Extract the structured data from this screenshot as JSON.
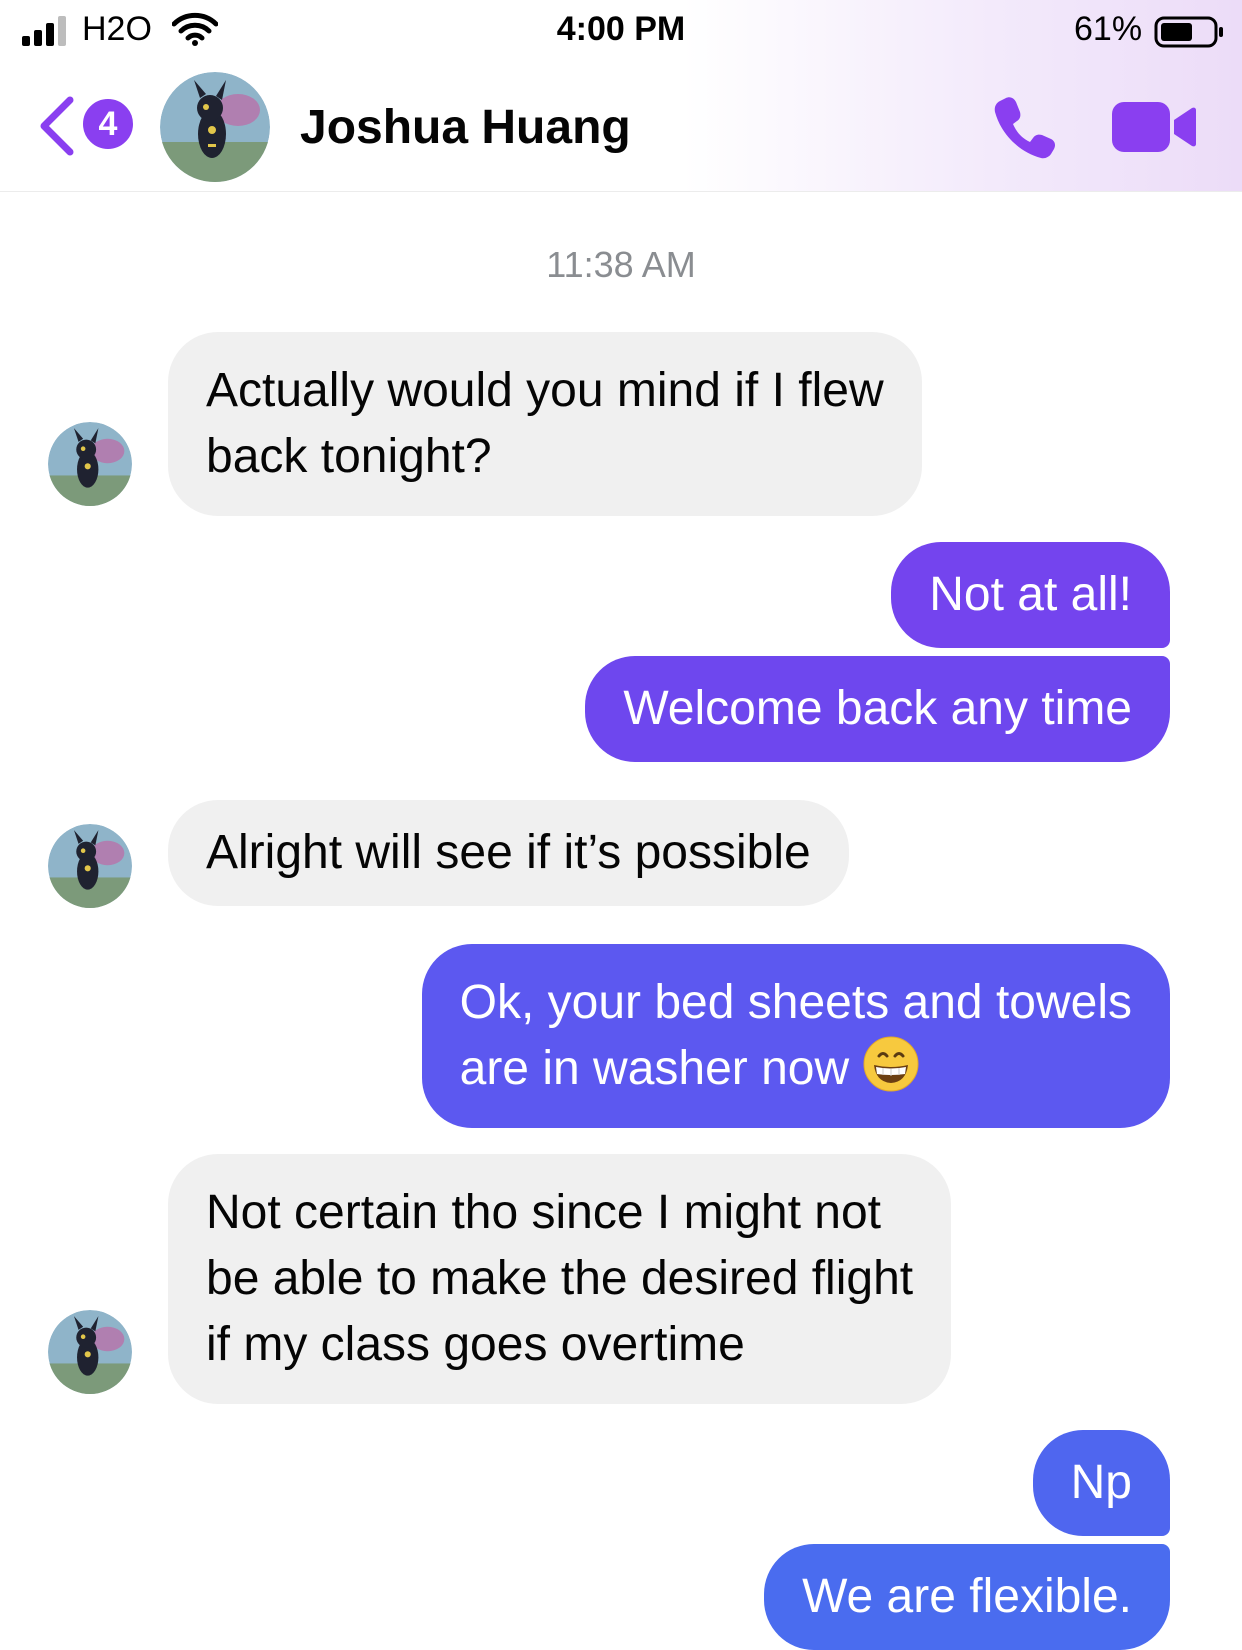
{
  "status_bar": {
    "carrier": "H2O",
    "time": "4:00 PM",
    "battery_percent": "61%",
    "battery_level": 0.61
  },
  "header": {
    "back_badge_count": "4",
    "contact_name": "Joshua Huang",
    "icons": [
      "back-chevron-icon",
      "phone-icon",
      "video-camera-icon"
    ],
    "accent_color": "#8a3ff0"
  },
  "conversation": {
    "timestamp": "11:38 AM",
    "messages": [
      {
        "direction": "incoming",
        "lines": [
          "Actually would you mind if I flew",
          "back tonight?"
        ]
      },
      {
        "direction": "outgoing",
        "lines": [
          "Not at all!"
        ]
      },
      {
        "direction": "outgoing",
        "lines": [
          "Welcome back any time"
        ]
      },
      {
        "direction": "incoming",
        "lines": [
          "Alright will see if it’s possible"
        ]
      },
      {
        "direction": "outgoing",
        "lines": [
          "Ok, your bed sheets and towels",
          "are in washer now"
        ],
        "emoji": "grinning-face-emoji"
      },
      {
        "direction": "incoming",
        "lines": [
          "Not certain tho since I might not",
          "be able to make the desired flight",
          "if my class goes overtime"
        ]
      },
      {
        "direction": "outgoing",
        "lines": [
          "Np"
        ]
      },
      {
        "direction": "outgoing",
        "lines": [
          "We are flexible."
        ]
      }
    ]
  }
}
